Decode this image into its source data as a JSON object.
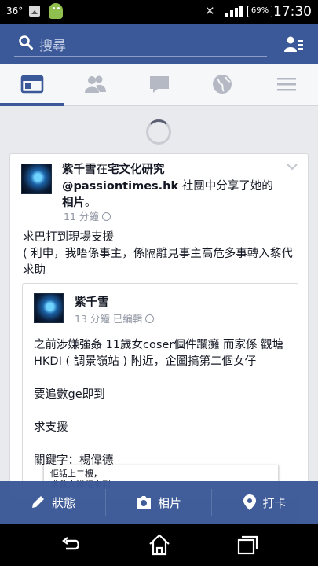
{
  "status_bar": {
    "temperature": "36°",
    "battery_percent": "69%",
    "time": "17:30"
  },
  "header": {
    "search_placeholder": "搜尋"
  },
  "tabs": [
    {
      "name": "news-feed",
      "icon": "news-feed-icon",
      "active": true
    },
    {
      "name": "friend-requests",
      "icon": "friends-icon",
      "active": false
    },
    {
      "name": "messages",
      "icon": "chat-bubble-icon",
      "active": false
    },
    {
      "name": "notifications",
      "icon": "globe-icon",
      "active": false
    },
    {
      "name": "menu",
      "icon": "hamburger-icon",
      "active": false
    }
  ],
  "post": {
    "author": "紫千雪",
    "connector_in": "在",
    "group": "宅文化研究@passiontimes.hk",
    "action_text": "社團中分享了她的",
    "photo_word": "相片",
    "end_punct": "。",
    "time": "11 分鐘",
    "text": "求巴打到現場支援\n( 利申，我唔係事主，係隔離見事主高危多事轉入黎代求助"
  },
  "shared": {
    "author": "紫千雪",
    "meta": "13 分鐘 已編輯",
    "text": "之前涉嫌強姦 11歲女coser個件躝癱 而家係 觀塘HKDI ( 調景嶺站 ) 附近，企圖搞第二個女仔\n\n要追數ge即到\n\n求支援\n\n關鍵字：楊偉德",
    "quote_text": "佢話上二樓，\n求救人睇佢來到"
  },
  "composer": {
    "status_label": "狀態",
    "photo_label": "相片",
    "checkin_label": "打卡"
  },
  "colors": {
    "brand_blue": "#3b5998",
    "background": "#e9eaee",
    "meta_gray": "#9197a3"
  }
}
